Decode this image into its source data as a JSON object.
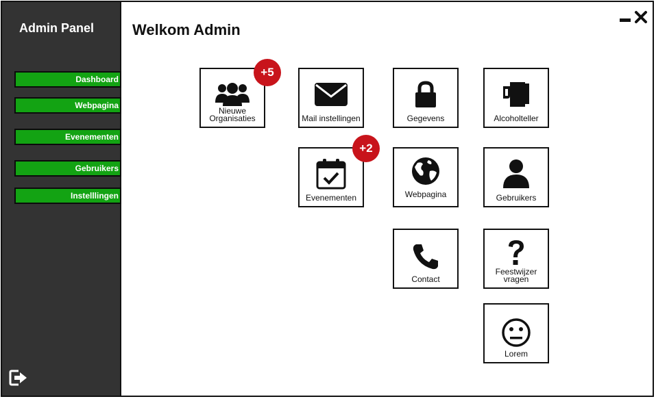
{
  "sidebar": {
    "brand": "Admin Panel",
    "items": [
      {
        "label": "Dashboard"
      },
      {
        "label": "Webpagina"
      },
      {
        "label": "Evenementen"
      },
      {
        "label": "Gebruikers"
      },
      {
        "label": "Instelllingen"
      }
    ],
    "logout_icon": "sign-out-icon",
    "accent_color": "#13a313"
  },
  "header": {
    "title": "Welkom Admin"
  },
  "tiles": {
    "nieuwe_organisaties": {
      "label_line1": "Nieuwe",
      "label_line2": "Organisaties",
      "icon": "users-icon",
      "badge": "+5"
    },
    "mail_instellingen": {
      "label": "Mail instellingen",
      "icon": "envelope-icon"
    },
    "gegevens": {
      "label": "Gegevens",
      "icon": "lock-icon"
    },
    "alcoholteller": {
      "label": "Alcoholteller",
      "icon": "beer-mug-icon"
    },
    "evenementen": {
      "label": "Evenementen",
      "icon": "calendar-check-icon",
      "badge": "+2"
    },
    "webpagina": {
      "label": "Webpagina",
      "icon": "globe-icon"
    },
    "gebruikers": {
      "label": "Gebruikers",
      "icon": "user-icon"
    },
    "contact": {
      "label": "Contact",
      "icon": "phone-icon"
    },
    "feestwijzer": {
      "label_line1": "Feestwijzer",
      "label_line2": "vragen",
      "icon": "question-icon"
    },
    "lorem": {
      "label": "Lorem",
      "icon": "neutral-face-icon"
    }
  },
  "badge_color": "#c8141b"
}
